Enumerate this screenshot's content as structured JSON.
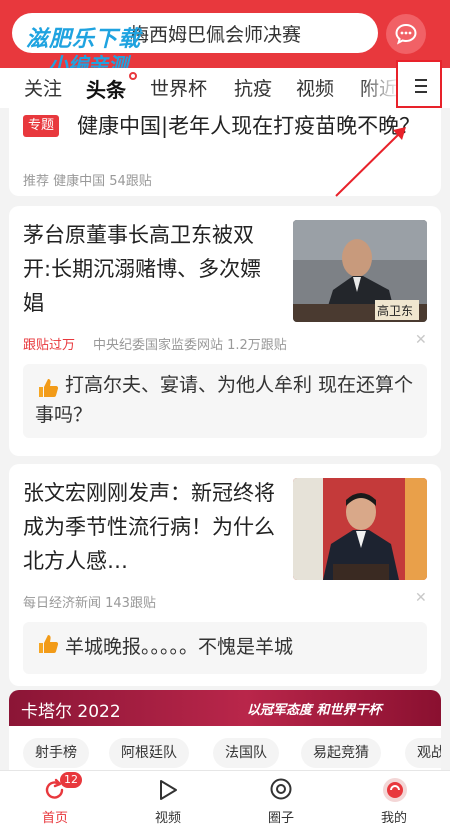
{
  "header": {
    "search_text": "梅西姆巴佩会师决赛",
    "watermark_line1": "滋肥乐下载",
    "watermark_line2": "小编亲测"
  },
  "tabs": [
    {
      "label": "关注"
    },
    {
      "label": "头条",
      "active": true
    },
    {
      "label": "世界杯"
    },
    {
      "label": "抗疫"
    },
    {
      "label": "视频"
    },
    {
      "label": "附近"
    }
  ],
  "menu_icon": "hamburger-menu-icon",
  "feed": {
    "card1": {
      "tag": "专题",
      "title": "健康中国|老年人现在打疫苗晚不晚？",
      "meta": "推荐   健康中国   54跟贴"
    },
    "card2": {
      "title": "茅台原董事长高卫东被双开:长期沉溺赌博、多次嫖娼",
      "thumb_caption": "高卫东",
      "hot_label": "跟贴过万",
      "meta": "中央纪委国家监委网站   1.2万跟贴",
      "hot_comment": "打高尔夫、宴请、为他人牟利 现在还算个事吗？"
    },
    "card3": {
      "title": "张文宏刚刚发声：新冠终将成为季节性流行病！为什么北方人感…",
      "meta": "每日经济新闻   143跟贴",
      "hot_comment": "羊城晚报。。。。。不愧是羊城"
    }
  },
  "qatar": {
    "title": "卡塔尔 2022",
    "slogan": "以冠军态度 和世界干杯",
    "chips": [
      "射手榜",
      "阿根廷队",
      "法国队",
      "易起竞猜",
      "观战"
    ]
  },
  "bottom_nav": [
    {
      "label": "首页",
      "badge": "12",
      "active": true
    },
    {
      "label": "视频"
    },
    {
      "label": "圈子"
    },
    {
      "label": "我的"
    }
  ],
  "colors": {
    "brand": "#e8383d",
    "watermark": "#1fa3e0",
    "highlight_box": "#e8222a"
  }
}
